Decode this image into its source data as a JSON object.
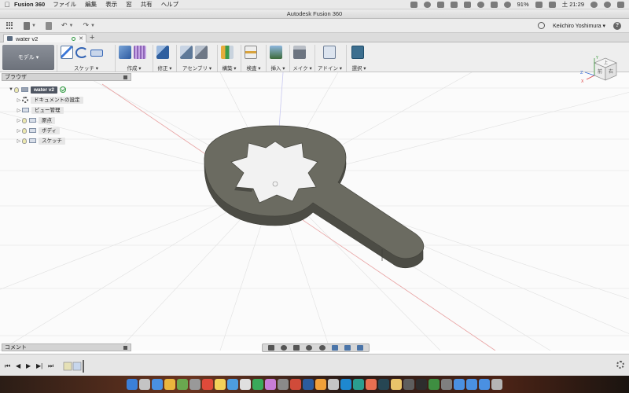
{
  "menubar": {
    "app_name": "Fusion 360",
    "items": [
      "ファイル",
      "編集",
      "表示",
      "窓",
      "共有",
      "ヘルプ"
    ],
    "battery": "91%",
    "time": "土 21:29"
  },
  "window": {
    "title": "Autodesk Fusion 360"
  },
  "app_toolbar": {
    "user": "Keiichiro Yoshimura ▾"
  },
  "document_tab": {
    "name": "water v2"
  },
  "ribbon": {
    "workspace": "モデル ▾",
    "groups": {
      "sketch": "スケッチ ▾",
      "create": "作成 ▾",
      "modify": "修正 ▾",
      "assemble": "アセンブリ ▾",
      "build": "構築 ▾",
      "inspect": "検査 ▾",
      "insert": "挿入 ▾",
      "make": "メイク ▾",
      "addin": "アドイン ▾",
      "select": "選択 ▾"
    }
  },
  "browser": {
    "title": "ブラウザ",
    "root": "water v2",
    "items": [
      "ドキュメントの設定",
      "ビュー管理",
      "原点",
      "ボディ",
      "スケッチ"
    ]
  },
  "viewcube": {
    "top": "上",
    "front": "前",
    "right": "右",
    "axis_x": "X",
    "axis_y": "Y",
    "axis_z": "Z"
  },
  "comments": {
    "label": "コメント"
  },
  "timeline": {
    "buttons": {
      "first": "⏮",
      "prev": "◀",
      "play": "▶",
      "next": "▶|",
      "last": "⏭"
    }
  },
  "colors": {
    "model_top": "#6a6a60",
    "model_side": "#56564e",
    "grid": "#dcdcdc",
    "axis_red": "#e58a8a",
    "accent": "#4a74a8"
  }
}
